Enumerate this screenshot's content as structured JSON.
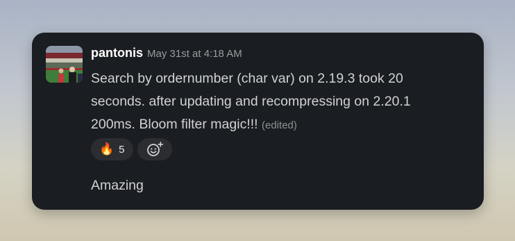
{
  "message": {
    "username": "pantonis",
    "timestamp": "May 31st at 4:18 AM",
    "line1": "Search by ordernumber (char var) on 2.19.3 took 20",
    "line2": "seconds. after updating and recompressing on 2.20.1",
    "line3": "200ms. Bloom filter magic!!!",
    "edited_label": "(edited)"
  },
  "reactions": [
    {
      "emoji": "🔥",
      "icon": "fire-icon",
      "count": "5"
    }
  ],
  "add_reaction_icon": "add-emoji-icon",
  "reply": {
    "text": "Amazing"
  },
  "colors": {
    "card_background": "#1a1d21",
    "username": "#ffffff",
    "body_text": "#d1d2d3",
    "muted_text": "#9a9ca0",
    "pill_background": "#2b2d31"
  }
}
